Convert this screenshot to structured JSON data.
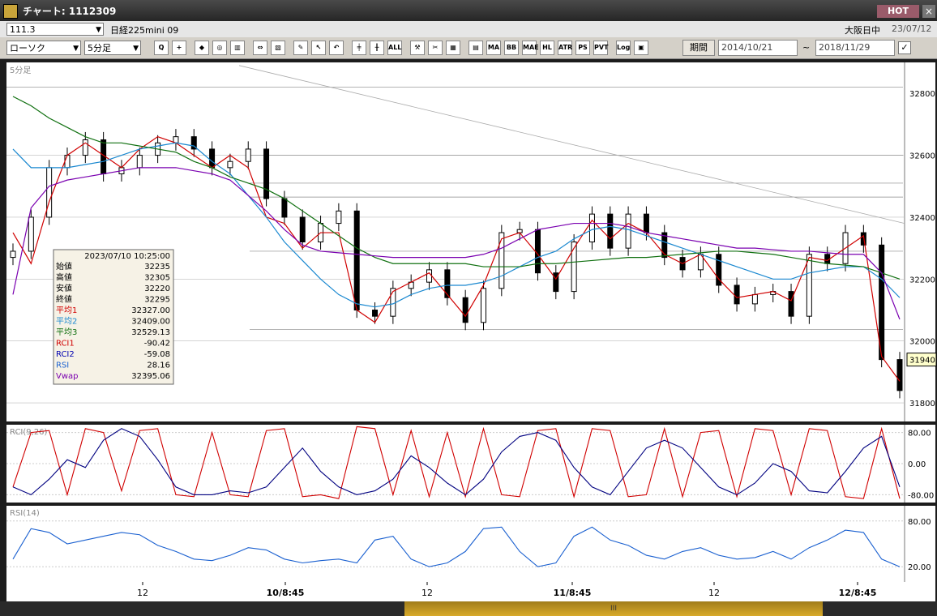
{
  "window": {
    "title": "チャート: 1112309",
    "hot_label": "HOT",
    "close_label": "×"
  },
  "header": {
    "code_value": "111.3",
    "instrument": "日経225mini 09",
    "session": "大阪日中",
    "date": "23/07/12"
  },
  "toolbar": {
    "chart_type": "ローソク",
    "interval": "5分足",
    "icons": [
      {
        "name": "zoom-icon",
        "label": "Q"
      },
      {
        "name": "crosshair-icon",
        "label": "+"
      },
      {
        "name": "cursor-icon",
        "label": "◆"
      },
      {
        "name": "magnify-icon",
        "label": "◎"
      },
      {
        "name": "bars-icon",
        "label": "▥"
      },
      {
        "name": "split-icon",
        "label": "⇔"
      },
      {
        "name": "lock-icon",
        "label": "▧"
      },
      {
        "name": "pencil-icon",
        "label": "✎"
      },
      {
        "name": "arrow-icon",
        "label": "↖"
      },
      {
        "name": "undo-icon",
        "label": "↶"
      },
      {
        "name": "candle-a-icon",
        "label": "╪"
      },
      {
        "name": "candle-b-icon",
        "label": "╫"
      },
      {
        "name": "all-icon",
        "label": "ALL"
      },
      {
        "name": "tools-icon",
        "label": "⚒"
      },
      {
        "name": "wrench-icon",
        "label": "✂"
      },
      {
        "name": "palette-icon",
        "label": "▦"
      },
      {
        "name": "table-icon",
        "label": "▤"
      },
      {
        "name": "ma-icon",
        "label": "MA"
      },
      {
        "name": "bb-icon",
        "label": "BB"
      },
      {
        "name": "mae-icon",
        "label": "MAE"
      },
      {
        "name": "hl-icon",
        "label": "HL"
      },
      {
        "name": "atr-icon",
        "label": "ATR"
      },
      {
        "name": "ps-icon",
        "label": "PS"
      },
      {
        "name": "pvt-icon",
        "label": "PVT"
      },
      {
        "name": "log-icon",
        "label": "Log"
      },
      {
        "name": "layout-icon",
        "label": "▣"
      }
    ],
    "period_button": "期間",
    "date_from": "2014/10/21",
    "tilde": "~",
    "date_to": "2018/11/29",
    "check": "✓"
  },
  "main_panel": {
    "label": "5分足",
    "current_price": "31940",
    "y_ticks": [
      "32800",
      "32600",
      "32400",
      "32200",
      "32000",
      "31800"
    ]
  },
  "info_box": {
    "timestamp": "2023/07/10  10:25:00",
    "rows": [
      {
        "label": "始値",
        "value": "32235",
        "color": "#000000"
      },
      {
        "label": "高値",
        "value": "32305",
        "color": "#000000"
      },
      {
        "label": "安値",
        "value": "32220",
        "color": "#000000"
      },
      {
        "label": "終値",
        "value": "32295",
        "color": "#000000"
      },
      {
        "label": "平均1",
        "value": "32327.00",
        "color": "#d00000"
      },
      {
        "label": "平均2",
        "value": "32409.00",
        "color": "#1a88d0"
      },
      {
        "label": "平均3",
        "value": "32529.13",
        "color": "#107010"
      },
      {
        "label": "RCI1",
        "value": "-90.42",
        "color": "#d00000"
      },
      {
        "label": "RCI2",
        "value": "-59.08",
        "color": "#0000b0"
      },
      {
        "label": "RSI",
        "value": "28.16",
        "color": "#1a60d0"
      },
      {
        "label": "Vwap",
        "value": "32395.06",
        "color": "#7a00b0"
      }
    ]
  },
  "rci_panel": {
    "label": "RCI(9,26)",
    "y_ticks": [
      "80.00",
      "0.00",
      "-80.00"
    ]
  },
  "rsi_panel": {
    "label": "RSI(14)",
    "y_ticks": [
      "80.00",
      "20.00"
    ]
  },
  "x_axis": {
    "labels": [
      "12",
      "10/8:45",
      "12",
      "11/8:45",
      "12",
      "12/8:45"
    ]
  },
  "scrollbar": {
    "grip": "III"
  },
  "chart_data": {
    "type": "line",
    "subtype": "candlestick",
    "y_range": [
      31740,
      32900
    ],
    "price_grid": [
      32600,
      32400,
      32200,
      32000,
      31800
    ],
    "horizontal_levels": [
      32820,
      32600,
      32510,
      32465,
      32290,
      32037
    ],
    "series": [
      {
        "name": "平均1",
        "color": "#d00000",
        "values": [
          32350,
          32250,
          32450,
          32600,
          32640,
          32600,
          32560,
          32620,
          32660,
          32640,
          32600,
          32560,
          32600,
          32560,
          32400,
          32380,
          32300,
          32350,
          32350,
          32100,
          32060,
          32160,
          32190,
          32220,
          32150,
          32080,
          32180,
          32330,
          32350,
          32280,
          32200,
          32300,
          32390,
          32330,
          32380,
          32350,
          32280,
          32250,
          32280,
          32200,
          32140,
          32150,
          32160,
          32130,
          32270,
          32260,
          32300,
          32340,
          31950,
          31870
        ]
      },
      {
        "name": "平均2",
        "color": "#1a88d0",
        "values": [
          32620,
          32560,
          32560,
          32560,
          32570,
          32580,
          32600,
          32620,
          32630,
          32640,
          32630,
          32580,
          32540,
          32470,
          32400,
          32320,
          32260,
          32200,
          32150,
          32120,
          32110,
          32120,
          32150,
          32170,
          32180,
          32180,
          32190,
          32210,
          32240,
          32270,
          32290,
          32330,
          32360,
          32370,
          32360,
          32340,
          32320,
          32300,
          32280,
          32260,
          32240,
          32220,
          32200,
          32200,
          32220,
          32230,
          32240,
          32240,
          32200,
          32140
        ]
      },
      {
        "name": "平均3",
        "color": "#107010",
        "values": [
          32790,
          32760,
          32720,
          32690,
          32660,
          32640,
          32640,
          32630,
          32620,
          32610,
          32580,
          32560,
          32530,
          32510,
          32490,
          32460,
          32420,
          32380,
          32340,
          32300,
          32270,
          32250,
          32250,
          32250,
          32250,
          32250,
          32240,
          32240,
          32240,
          32250,
          32250,
          32255,
          32260,
          32265,
          32270,
          32270,
          32275,
          32280,
          32285,
          32290,
          32290,
          32285,
          32280,
          32270,
          32260,
          32250,
          32245,
          32240,
          32220,
          32200
        ]
      },
      {
        "name": "Vwap",
        "color": "#7a00b0",
        "values": [
          32150,
          32430,
          32500,
          32520,
          32530,
          32540,
          32550,
          32560,
          32560,
          32560,
          32550,
          32540,
          32520,
          32470,
          32420,
          32360,
          32310,
          32290,
          32285,
          32280,
          32275,
          32270,
          32270,
          32270,
          32270,
          32270,
          32280,
          32300,
          32330,
          32360,
          32370,
          32380,
          32380,
          32380,
          32370,
          32350,
          32340,
          32330,
          32320,
          32310,
          32300,
          32300,
          32295,
          32290,
          32290,
          32285,
          32280,
          32280,
          32220,
          32070
        ]
      }
    ],
    "candles_close": [
      32290,
      32400,
      32560,
      32600,
      32650,
      32540,
      32560,
      32600,
      32640,
      32660,
      32620,
      32560,
      32580,
      32620,
      32460,
      32400,
      32320,
      32380,
      32420,
      32100,
      32080,
      32170,
      32190,
      32230,
      32140,
      32060,
      32170,
      32350,
      32360,
      32220,
      32160,
      32320,
      32410,
      32300,
      32410,
      32350,
      32270,
      32230,
      32280,
      32180,
      32120,
      32150,
      32160,
      32080,
      32280,
      32250,
      32350,
      32310,
      31940,
      31840
    ],
    "rci": {
      "y_range": [
        -100,
        100
      ],
      "series": [
        {
          "name": "RCI1",
          "color": "#d00000",
          "values": [
            -60,
            80,
            85,
            -80,
            90,
            80,
            -70,
            85,
            90,
            -80,
            -85,
            80,
            -80,
            -85,
            85,
            90,
            -85,
            -80,
            -90,
            95,
            90,
            -80,
            85,
            -85,
            80,
            -85,
            90,
            -80,
            -85,
            85,
            90,
            -85,
            90,
            85,
            -85,
            -80,
            90,
            -85,
            80,
            85,
            -85,
            90,
            85,
            -80,
            90,
            85,
            -85,
            -90,
            90,
            -90
          ]
        },
        {
          "name": "RCI2",
          "color": "#000080",
          "values": [
            -60,
            -80,
            -40,
            10,
            -10,
            60,
            90,
            70,
            10,
            -60,
            -80,
            -80,
            -70,
            -75,
            -60,
            -10,
            40,
            -20,
            -60,
            -80,
            -70,
            -40,
            20,
            -10,
            -50,
            -80,
            -40,
            30,
            70,
            80,
            60,
            -10,
            -60,
            -80,
            -20,
            40,
            60,
            40,
            -10,
            -60,
            -80,
            -50,
            0,
            -20,
            -70,
            -75,
            -20,
            40,
            70,
            -60
          ]
        }
      ]
    },
    "rsi": {
      "y_range": [
        0,
        100
      ],
      "series": [
        {
          "name": "RSI",
          "color": "#1a60d0",
          "values": [
            30,
            70,
            65,
            50,
            55,
            60,
            65,
            62,
            48,
            40,
            30,
            28,
            35,
            45,
            42,
            30,
            25,
            28,
            30,
            25,
            55,
            60,
            30,
            20,
            25,
            40,
            70,
            72,
            40,
            20,
            25,
            60,
            72,
            55,
            48,
            35,
            30,
            40,
            45,
            35,
            30,
            32,
            40,
            30,
            45,
            55,
            68,
            65,
            30,
            20
          ]
        }
      ]
    }
  }
}
